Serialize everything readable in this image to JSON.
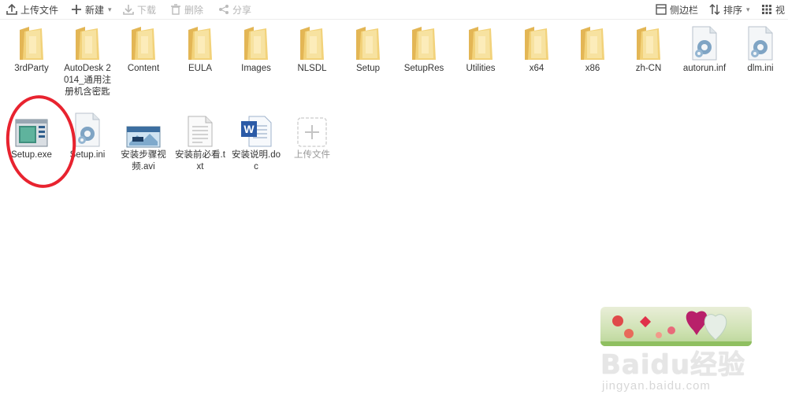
{
  "toolbar": {
    "upload_label": "上传文件",
    "new_label": "新建",
    "download_label": "下载",
    "delete_label": "删除",
    "share_label": "分享",
    "sidebar_label": "侧边栏",
    "sort_label": "排序",
    "view_label": "视"
  },
  "files": [
    {
      "name": "3rdParty",
      "type": "folder"
    },
    {
      "name": "AutoDesk 2014_通用注册机含密匙",
      "type": "folder"
    },
    {
      "name": "Content",
      "type": "folder"
    },
    {
      "name": "EULA",
      "type": "folder"
    },
    {
      "name": "Images",
      "type": "folder"
    },
    {
      "name": "NLSDL",
      "type": "folder"
    },
    {
      "name": "Setup",
      "type": "folder"
    },
    {
      "name": "SetupRes",
      "type": "folder"
    },
    {
      "name": "Utilities",
      "type": "folder"
    },
    {
      "name": "x64",
      "type": "folder"
    },
    {
      "name": "x86",
      "type": "folder"
    },
    {
      "name": "zh-CN",
      "type": "folder"
    },
    {
      "name": "autorun.inf",
      "type": "config-file"
    },
    {
      "name": "dlm.ini",
      "type": "config-file"
    },
    {
      "name": "Setup.exe",
      "type": "exe"
    },
    {
      "name": "Setup.ini",
      "type": "config-file"
    },
    {
      "name": "安装步骤视频.avi",
      "type": "video"
    },
    {
      "name": "安装前必看.txt",
      "type": "text"
    },
    {
      "name": "安装说明.doc",
      "type": "word"
    },
    {
      "name": "上传文件",
      "type": "upload"
    }
  ],
  "watermark": {
    "brand": "Baidu经验",
    "url": "jingyan.baidu.com"
  },
  "colors": {
    "folder": "#f2d27a",
    "annotation": "#e8232f"
  }
}
